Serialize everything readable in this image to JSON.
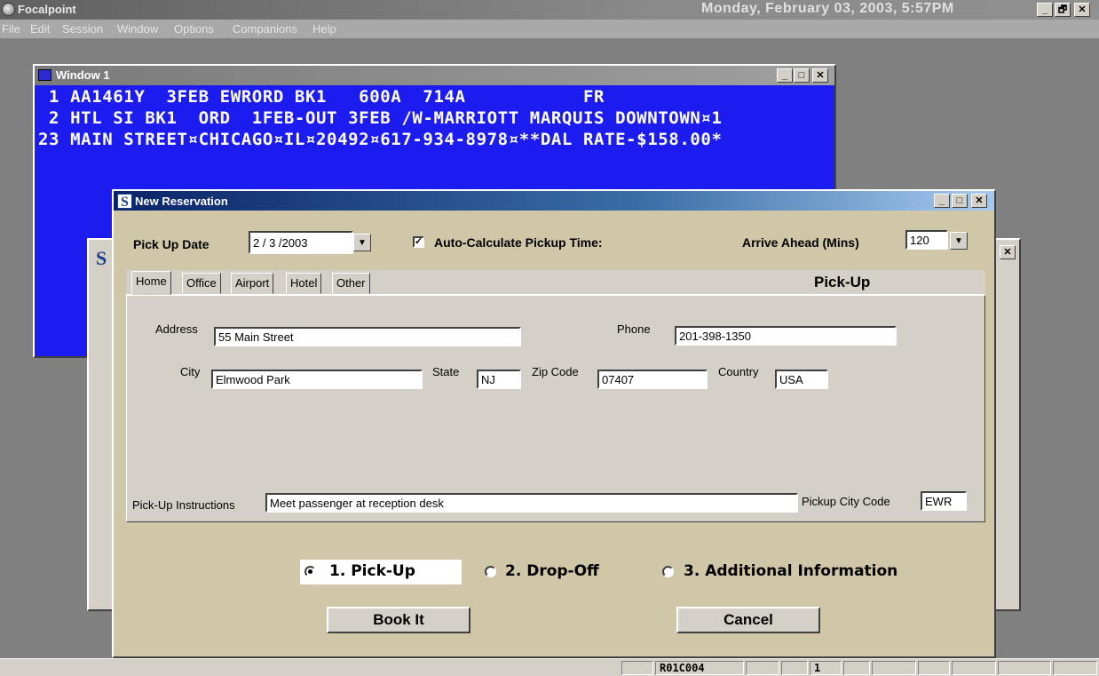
{
  "app": {
    "title": "Focalpoint",
    "datetime": "Monday, February 03, 2003, 5:57PM",
    "controls": {
      "minimize": "_",
      "maximize": "🗗",
      "close": "✕"
    }
  },
  "menu": {
    "items": [
      "File",
      "Edit",
      "Session",
      "Window",
      "Options",
      "Companions",
      "Help"
    ]
  },
  "window1": {
    "title": "Window 1",
    "lines": [
      " 1 AA1461Y  3FEB EWRORD BK1   600A  714A           FR",
      " 2 HTL SI BK1  ORD  1FEB-OUT 3FEB /W-MARRIOTT MARQUIS DOWNTOWN¤1",
      "23 MAIN STREET¤CHICAGO¤IL¤20492¤617-934-8978¤**DAL RATE-$158.00*"
    ]
  },
  "background_dialog": {
    "icon_letter": "S"
  },
  "dialog": {
    "title": "New Reservation",
    "icon_letter": "S",
    "pickup_date_label": "Pick Up Date",
    "pickup_date_value": "2 / 3 /2003",
    "auto_calc_label": "Auto-Calculate Pickup Time:",
    "auto_calc_checked": "✓",
    "arrive_ahead_label": "Arrive Ahead (Mins)",
    "arrive_ahead_value": "120",
    "tabs": [
      "Home",
      "Office",
      "Airport",
      "Hotel",
      "Other"
    ],
    "tab_heading": "Pick-Up",
    "fields": {
      "address_label": "Address",
      "address_value": "55 Main Street",
      "phone_label": "Phone",
      "phone_value": "201-398-1350",
      "city_label": "City",
      "city_value": "Elmwood Park",
      "state_label": "State",
      "state_value": "NJ",
      "zip_label": "Zip Code",
      "zip_value": "07407",
      "country_label": "Country",
      "country_value": "USA",
      "instructions_label": "Pick-Up Instructions",
      "instructions_value": "Meet passenger at reception desk",
      "city_code_label": "Pickup City Code",
      "city_code_value": "EWR"
    },
    "radios": [
      {
        "label": "1. Pick-Up",
        "selected": true
      },
      {
        "label": "2. Drop-Off",
        "selected": false
      },
      {
        "label": "3. Additional Information",
        "selected": false
      }
    ],
    "book_button": "Book It",
    "cancel_button": "Cancel"
  },
  "statusbar": {
    "code": "R01C004",
    "indicator": "1"
  }
}
